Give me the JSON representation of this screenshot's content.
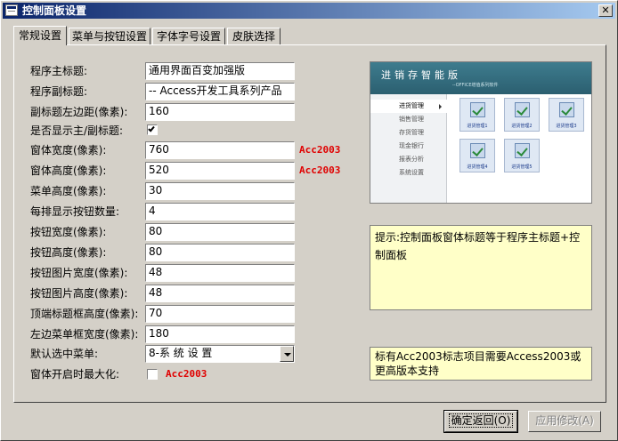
{
  "window": {
    "title": "控制面板设置",
    "close_symbol": "✕"
  },
  "tabs": [
    {
      "label": "常规设置",
      "active": true
    },
    {
      "label": "菜单与按钮设置",
      "active": false
    },
    {
      "label": "字体字号设置",
      "active": false
    },
    {
      "label": "皮肤选择",
      "active": false
    }
  ],
  "form": {
    "main_title": {
      "label": "程序主标题:",
      "value": "通用界面百变加强版"
    },
    "sub_title": {
      "label": "程序副标题:",
      "value": "-- Access开发工具系列产品"
    },
    "sub_title_left_margin": {
      "label": "副标题左边距(像素):",
      "value": "160"
    },
    "show_titles": {
      "label": "是否显示主/副标题:",
      "checked": true
    },
    "form_width": {
      "label": "窗体宽度(像素):",
      "value": "760",
      "tag": "Acc2003"
    },
    "form_height": {
      "label": "窗体高度(像素):",
      "value": "520",
      "tag": "Acc2003"
    },
    "menu_height": {
      "label": "菜单高度(像素):",
      "value": "30"
    },
    "buttons_per_row": {
      "label": "每排显示按钮数量:",
      "value": "4"
    },
    "button_width": {
      "label": "按钮宽度(像素):",
      "value": "80"
    },
    "button_height": {
      "label": "按钮高度(像素):",
      "value": "80"
    },
    "button_image_width": {
      "label": "按钮图片宽度(像素):",
      "value": "48"
    },
    "button_image_height": {
      "label": "按钮图片高度(像素):",
      "value": "48"
    },
    "top_title_height": {
      "label": "顶端标题框高度(像素):",
      "value": "70"
    },
    "left_menu_width": {
      "label": "左边菜单框宽度(像素):",
      "value": "180"
    },
    "default_menu": {
      "label": "默认选中菜单:",
      "value": "8-系 统 设 置"
    },
    "maximize_on_open": {
      "label": "窗体开启时最大化:",
      "checked": false,
      "tag": "Acc2003"
    }
  },
  "preview": {
    "title": "进销存智能版",
    "subtitle": "--OFFICE增值系列软件",
    "menu_items": [
      "进货管理",
      "销售管理",
      "存货管理",
      "现金银行",
      "报表分析",
      "系统设置"
    ],
    "selected_menu_index": 0,
    "buttons": [
      "进货管理1",
      "进货管理2",
      "进货管理3",
      "进货管理4",
      "进货管理5"
    ],
    "colors": {
      "header": "#2b5f70",
      "button_bg": "#dfe8f4"
    }
  },
  "hints": {
    "tip": "提示:控制面板窗体标题等于程序主标题+控制面板",
    "acc2003_note": "标有Acc2003标志项目需要Access2003或更高版本支持"
  },
  "buttons": {
    "confirm_label": "确定返回(O)",
    "apply_label": "应用修改(A)"
  },
  "colors": {
    "title_bar": "#0a246a",
    "tag": "#e00000",
    "hint_bg": "#ffffc8",
    "face": "#d4d0c8"
  }
}
